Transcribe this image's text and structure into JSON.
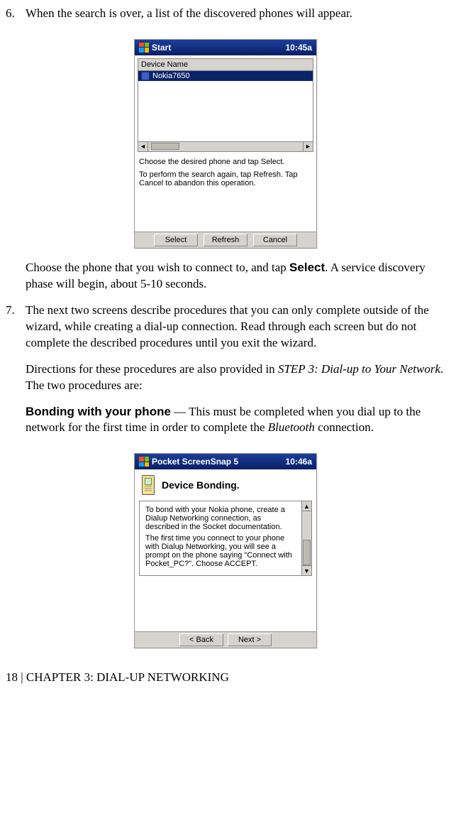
{
  "steps": {
    "s6": {
      "num": "6.",
      "intro": "When the search is over, a list of the discovered phones will appear.",
      "after_a": "Choose the phone that you wish to connect to, and tap ",
      "after_b_bold": "Select",
      "after_c": ". A service discovery phase will begin, about 5-10 seconds."
    },
    "s7": {
      "num": "7.",
      "p1": "The next two screens describe procedures that you can only complete outside of the wizard, while creating a dial-up connection. Read through each screen but do not complete the described procedures until you exit the wizard.",
      "p2_a": "Directions for these procedures are also provided in ",
      "p2_b_italic": "STEP 3: Dial-up to Your Network",
      "p2_c": ". The two procedures are:",
      "bond_a_bold": "Bonding with your phone",
      "bond_b": " — This must be completed when you dial up to the network for the first time in order to complete the ",
      "bond_c_italic": "Bluetooth",
      "bond_d": " connection."
    }
  },
  "shot1": {
    "title": "Start",
    "time": "10:45a",
    "column_header": "Device Name",
    "device": "Nokia7650",
    "hint1": "Choose the desired phone and tap Select.",
    "hint2": "To perform the search again, tap Refresh. Tap Cancel to abandon this operation.",
    "btn_select": "Select",
    "btn_refresh": "Refresh",
    "btn_cancel": "Cancel"
  },
  "shot2": {
    "title": "Pocket ScreenSnap 5",
    "time": "10:46a",
    "heading": "Device Bonding.",
    "para1": "To bond with your Nokia phone, create a Dialup Networking connection, as described in the Socket documentation.",
    "para2": "The first time you connect to your phone with Dialup Networking, you will see a prompt on the phone saying \"Connect with Pocket_PC?\". Choose ACCEPT.",
    "btn_back": "< Back",
    "btn_next": "Next >"
  },
  "footer": "18 | CHAPTER 3: DIAL-UP NETWORKING"
}
